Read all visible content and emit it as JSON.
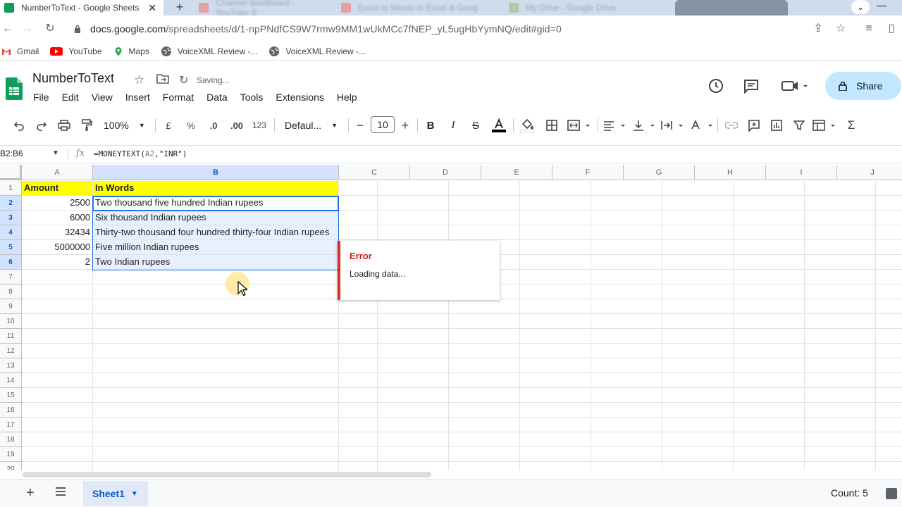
{
  "browser": {
    "active_tab_title": "NumberToText - Google Sheets",
    "inactive_tabs": [
      {
        "title": "Channel dashboard - YouTube S"
      },
      {
        "title": "Excel to Words in Excel & Goog"
      },
      {
        "title": "My Drive - Google Drive"
      }
    ],
    "url_host": "docs.google.com",
    "url_path": "/spreadsheets/d/1-npPNdfCS9W7rmw9MM1wUkMCc7fNEP_yL5ugHbYymNQ/edit#gid=0",
    "bookmarks": [
      {
        "label": "Gmail",
        "icon": "gmail-icon"
      },
      {
        "label": "YouTube",
        "icon": "youtube-icon"
      },
      {
        "label": "Maps",
        "icon": "maps-icon"
      },
      {
        "label": "VoiceXML Review -...",
        "icon": "globe-icon"
      },
      {
        "label": "VoiceXML Review -...",
        "icon": "globe-icon"
      }
    ]
  },
  "sheets": {
    "doc_title": "NumberToText",
    "save_status": "Saving...",
    "menu": [
      "File",
      "Edit",
      "View",
      "Insert",
      "Format",
      "Data",
      "Tools",
      "Extensions",
      "Help"
    ],
    "share_label": "Share"
  },
  "toolbar": {
    "zoom": "100%",
    "currency": "£",
    "percent": "%",
    "decrease_decimal": ".0",
    "increase_decimal": ".00",
    "more_formats": "123",
    "font": "Defaul...",
    "font_size": "10"
  },
  "formula_bar": {
    "name_box": "B2:B6",
    "fx": "fx",
    "formula_prefix": "=MONEYTEXT(",
    "formula_ref": "A2",
    "formula_suffix": ",\"INR\")"
  },
  "grid": {
    "columns": [
      "A",
      "B",
      "C",
      "D",
      "E",
      "F",
      "G",
      "H",
      "I",
      "J"
    ],
    "rows": [
      "1",
      "2",
      "3",
      "4",
      "5",
      "6",
      "7",
      "8",
      "9",
      "10",
      "11",
      "12",
      "13",
      "14",
      "15",
      "16",
      "17",
      "18",
      "19",
      "20"
    ],
    "header": {
      "a": "Amount",
      "b": "In Words"
    },
    "data": [
      {
        "a": "2500",
        "b": "Two thousand five hundred Indian rupees"
      },
      {
        "a": "6000",
        "b": "Six thousand Indian rupees"
      },
      {
        "a": "32434",
        "b": "Thirty-two thousand four hundred thirty-four Indian rupees"
      },
      {
        "a": "5000000",
        "b": "Five million Indian rupees"
      },
      {
        "a": "2",
        "b": "Two Indian rupees"
      }
    ]
  },
  "error_popup": {
    "title": "Error",
    "message": "Loading data..."
  },
  "sheetbar": {
    "sheet_name": "Sheet1",
    "count": "Count: 5"
  },
  "colors": {
    "header_fill": "#ffff00",
    "selection": "#1a73e8",
    "error": "#d93025",
    "share_bg": "#c2e7ff"
  }
}
